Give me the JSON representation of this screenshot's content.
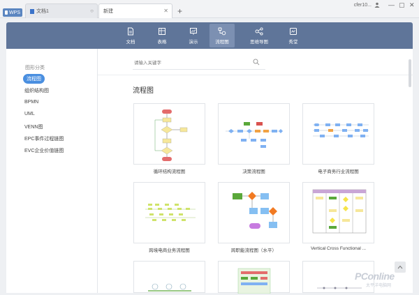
{
  "window": {
    "wps_tab": "WPS",
    "doc_tab": "文档1",
    "new_tab": "新建",
    "new_tab_plus": "+",
    "user_name": "cfer10..."
  },
  "toolbar": {
    "items": [
      {
        "label": "文档",
        "icon": "document-icon"
      },
      {
        "label": "表格",
        "icon": "table-icon"
      },
      {
        "label": "演示",
        "icon": "presentation-icon"
      },
      {
        "label": "流程图",
        "icon": "flowchart-icon",
        "active": true
      },
      {
        "label": "思维导图",
        "icon": "mindmap-icon"
      },
      {
        "label": "秀堂",
        "icon": "show-icon"
      }
    ]
  },
  "sidebar": {
    "heading": "图形分类",
    "items": [
      "流程图",
      "组织结构图",
      "BPMN",
      "UML",
      "VENN图",
      "EPC事件过程链图",
      "EVC企业价值链图"
    ]
  },
  "search": {
    "placeholder": "请输入关键字"
  },
  "section_title": "流程图",
  "cards": [
    {
      "label": "循环结构流程图"
    },
    {
      "label": "决策流程图"
    },
    {
      "label": "电子商务行业流程图"
    },
    {
      "label": "跨境电商业务流程图"
    },
    {
      "label": "跨职能流程图（水平）"
    },
    {
      "label": "Vertical Cross Functional ..."
    }
  ],
  "watermark": {
    "brand": "PConline",
    "sub": "太平洋电脑网"
  },
  "colors": {
    "toolbar": "#5f7599",
    "accent": "#4a8fe0"
  }
}
